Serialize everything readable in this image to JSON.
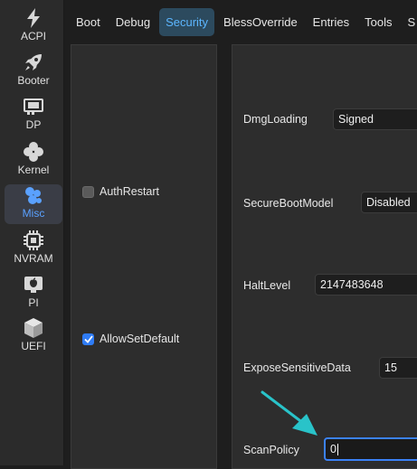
{
  "sidebar": {
    "items": [
      {
        "label": "ACPI",
        "icon": "lightning-icon"
      },
      {
        "label": "Booter",
        "icon": "rocket-icon"
      },
      {
        "label": "DP",
        "icon": "graphics-card-icon"
      },
      {
        "label": "Kernel",
        "icon": "puzzle-icon"
      },
      {
        "label": "Misc",
        "icon": "bubbles-icon"
      },
      {
        "label": "NVRAM",
        "icon": "chip-icon"
      },
      {
        "label": "PI",
        "icon": "apple-icon"
      },
      {
        "label": "UEFI",
        "icon": "cube-icon"
      }
    ],
    "active": "Misc",
    "accent": "#5aa1ff"
  },
  "tabs": {
    "items": [
      "Boot",
      "Debug",
      "Security",
      "BlessOverride",
      "Entries",
      "Tools",
      "S"
    ],
    "active": "Security",
    "accent": "#5cb6ff"
  },
  "left_panel": {
    "checkboxes": [
      {
        "label": "AuthRestart",
        "checked": false
      },
      {
        "label": "AllowSetDefault",
        "checked": true
      }
    ]
  },
  "fields": {
    "dmg_loading": {
      "label": "DmgLoading",
      "value": "Signed"
    },
    "secure_boot_model": {
      "label": "SecureBootModel",
      "value": "Disabled"
    },
    "halt_level": {
      "label": "HaltLevel",
      "value": "2147483648"
    },
    "expose_sensitive_data": {
      "label": "ExposeSensitiveData",
      "value": "15"
    },
    "scan_policy": {
      "label": "ScanPolicy",
      "value": "0"
    }
  },
  "annotation": {
    "color": "#29c3c9"
  }
}
